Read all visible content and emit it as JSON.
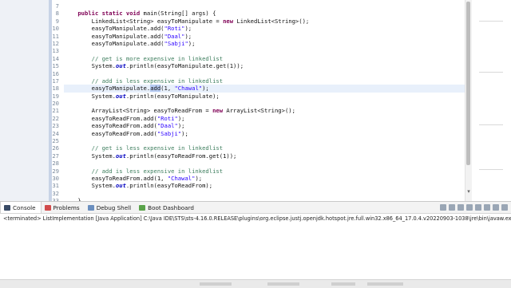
{
  "editor": {
    "line_numbers": [
      "7",
      "8",
      "9",
      "10",
      "11",
      "12",
      "13",
      "14",
      "15",
      "16",
      "17",
      "18",
      "19",
      "20",
      "21",
      "22",
      "23",
      "24",
      "25",
      "26",
      "27",
      "28",
      "29",
      "30",
      "31",
      "32",
      "33"
    ],
    "lines": [
      [],
      [
        {
          "t": "    "
        },
        {
          "t": "public",
          "c": "kw"
        },
        {
          "t": " "
        },
        {
          "t": "static",
          "c": "kw"
        },
        {
          "t": " "
        },
        {
          "t": "void",
          "c": "kw"
        },
        {
          "t": " main(String[] args) {"
        }
      ],
      [
        {
          "t": "        LinkedList<String> easyToManipulate = "
        },
        {
          "t": "new",
          "c": "kw"
        },
        {
          "t": " LinkedList<String>();"
        }
      ],
      [
        {
          "t": "        easyToManipulate.add("
        },
        {
          "t": "\"Roti\"",
          "c": "str"
        },
        {
          "t": ");"
        }
      ],
      [
        {
          "t": "        easyToManipulate.add("
        },
        {
          "t": "\"Daal\"",
          "c": "str"
        },
        {
          "t": ");"
        }
      ],
      [
        {
          "t": "        easyToManipulate.add("
        },
        {
          "t": "\"Sabji\"",
          "c": "str"
        },
        {
          "t": ");"
        }
      ],
      [],
      [
        {
          "t": "        // get is more expensive in linkedlist",
          "c": "cm"
        }
      ],
      [
        {
          "t": "        System."
        },
        {
          "t": "out",
          "c": "fld"
        },
        {
          "t": ".println(easyToManipulate.get(1));"
        }
      ],
      [],
      [
        {
          "t": "        // add is less expensive in linkedlist",
          "c": "cm"
        }
      ],
      [
        {
          "t": "        easyToManipulate."
        },
        {
          "t": "add",
          "c": "sel"
        },
        {
          "t": "(1, "
        },
        {
          "t": "\"Chawal\"",
          "c": "str"
        },
        {
          "t": ");"
        }
      ],
      [
        {
          "t": "        System."
        },
        {
          "t": "out",
          "c": "fld"
        },
        {
          "t": ".println(easyToManipulate);"
        }
      ],
      [],
      [
        {
          "t": "        ArrayList<String> easyToReadFrom = "
        },
        {
          "t": "new",
          "c": "kw"
        },
        {
          "t": " ArrayList<String>();"
        }
      ],
      [
        {
          "t": "        easyToReadFrom.add("
        },
        {
          "t": "\"Roti\"",
          "c": "str"
        },
        {
          "t": ");"
        }
      ],
      [
        {
          "t": "        easyToReadFrom.add("
        },
        {
          "t": "\"Daal\"",
          "c": "str"
        },
        {
          "t": ");"
        }
      ],
      [
        {
          "t": "        easyToReadFrom.add("
        },
        {
          "t": "\"Sabji\"",
          "c": "str"
        },
        {
          "t": ");"
        }
      ],
      [],
      [
        {
          "t": "        // get is less expensive in linkedlist",
          "c": "cm"
        }
      ],
      [
        {
          "t": "        System."
        },
        {
          "t": "out",
          "c": "fld"
        },
        {
          "t": ".println(easyToReadFrom.get(1));"
        }
      ],
      [],
      [
        {
          "t": "        // add is less expensive in linkedlist",
          "c": "cm"
        }
      ],
      [
        {
          "t": "        easyToReadFrom.add(1, "
        },
        {
          "t": "\"Chawal\"",
          "c": "str"
        },
        {
          "t": ");"
        }
      ],
      [
        {
          "t": "        System."
        },
        {
          "t": "out",
          "c": "fld"
        },
        {
          "t": ".println(easyToReadFrom);"
        }
      ],
      [],
      [
        {
          "t": "    }"
        }
      ]
    ],
    "current_line_index": 11
  },
  "console": {
    "tabs": [
      {
        "label": "Console",
        "icon": "console-icon",
        "active": true
      },
      {
        "label": "Problems",
        "icon": "problems-icon",
        "active": false
      },
      {
        "label": "Debug Shell",
        "icon": "debug-shell-icon",
        "active": false
      },
      {
        "label": "Boot Dashboard",
        "icon": "boot-dashboard-icon",
        "active": false
      }
    ],
    "header": "<terminated> ListImplementation [Java Application] C:\\Java IDE\\STS\\sts-4.16.0.RELEASE\\plugins\\org.eclipse.justj.openjdk.hotspot.jre.full.win32.x86_64_17.0.4.v20220903-1038\\jre\\bin\\javaw.exe"
  },
  "colors": {
    "keyword": "#7f0055",
    "string": "#2a00ff",
    "comment": "#3f7f5f",
    "field": "#0000c0",
    "selection": "#b7cbf2"
  }
}
